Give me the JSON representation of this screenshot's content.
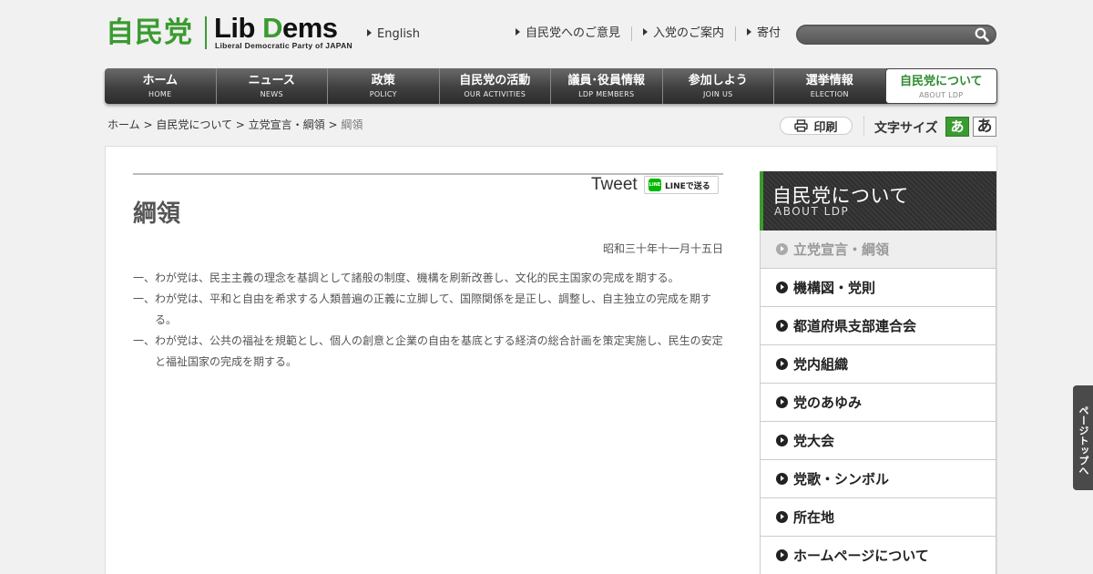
{
  "header": {
    "logo_ja": "自民党",
    "logo_en_lib": "Lib ",
    "logo_en_d": "D",
    "logo_en_ems": "ems",
    "logo_sub": "Liberal Democratic Party of JAPAN",
    "english_link": "English",
    "top_links": [
      "自民党へのご意見",
      "入党のご案内",
      "寄付"
    ],
    "search_placeholder": ""
  },
  "nav": [
    {
      "jp": "ホーム",
      "en": "HOME"
    },
    {
      "jp": "ニュース",
      "en": "NEWS"
    },
    {
      "jp": "政策",
      "en": "POLICY"
    },
    {
      "jp": "自民党の活動",
      "en": "OUR ACTIVITIES"
    },
    {
      "jp": "議員･役員情報",
      "en": "LDP MEMBERS"
    },
    {
      "jp": "参加しよう",
      "en": "JOIN US"
    },
    {
      "jp": "選挙情報",
      "en": "ELECTION"
    },
    {
      "jp": "自民党について",
      "en": "ABOUT LDP"
    }
  ],
  "breadcrumb": {
    "items": [
      "ホーム",
      "自民党について",
      "立党宣言・綱領"
    ],
    "separator": " > ",
    "current": "綱領"
  },
  "tools": {
    "print_label": "印刷",
    "font_size_label": "文字サイズ",
    "font_small": "あ",
    "font_large": "あ"
  },
  "content": {
    "tweet": "Tweet",
    "line_label": "LINEで送る",
    "line_icon": "LINE",
    "title": "綱領",
    "date": "昭和三十年十一月十五日",
    "paragraphs": [
      "一、わが党は、民主主義の理念を基調として諸般の制度、機構を刷新改善し、文化的民主国家の完成を期する。",
      "一、わが党は、平和と自由を希求する人類普遍の正義に立脚して、国際関係を是正し、調整し、自主独立の完成を期する。",
      "一、わが党は、公共の福祉を規範とし、個人の創意と企業の自由を基底とする経済の総合計画を策定実施し、民生の安定と福祉国家の完成を期する。"
    ]
  },
  "sidebar": {
    "title_jp": "自民党について",
    "title_en": "ABOUT LDP",
    "items": [
      "立党宣言・綱領",
      "機構図・党則",
      "都道府県支部連合会",
      "党内組織",
      "党のあゆみ",
      "党大会",
      "党歌・シンボル",
      "所在地",
      "ホームページについて"
    ]
  },
  "pagetop": "ページトップへ",
  "colors": {
    "brand_green": "#3a9b30",
    "nav_dark": "#3f3f3f"
  }
}
